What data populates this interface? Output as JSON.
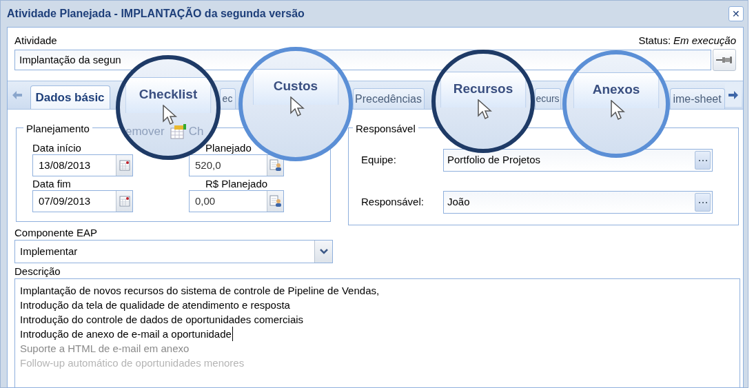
{
  "window": {
    "title": "Atividade Planejada - IMPLANTAÇÃO da segunda versão",
    "close": "✕"
  },
  "activity": {
    "label": "Atividade",
    "value": "Implantação da segun",
    "status_label": "Status:",
    "status_value": "Em execução"
  },
  "tabs": [
    {
      "label": "Dados básic",
      "selected": true
    },
    {
      "label": "ec",
      "selected": false
    },
    {
      "label": "Precedências",
      "selected": false
    },
    {
      "label": "ecurs",
      "selected": false
    },
    {
      "label": "ime-sheet",
      "selected": false
    }
  ],
  "planning": {
    "title": "Planejamento",
    "fields": [
      {
        "label": "Data início",
        "value": "13/08/2013",
        "kind": "date"
      },
      {
        "label": "Planejado",
        "value": "520,0",
        "kind": "calc"
      },
      {
        "label": "Data fim",
        "value": "07/09/2013",
        "kind": "date"
      },
      {
        "label": "R$ Planejado",
        "value": "0,00",
        "kind": "calc"
      }
    ]
  },
  "responsible": {
    "title": "Responsável",
    "fields": [
      {
        "label": "Equipe:",
        "value": "Portfolio de Projetos"
      },
      {
        "label": "Responsável:",
        "value": "João"
      }
    ]
  },
  "component": {
    "label": "Componente EAP",
    "value": "Implementar"
  },
  "description": {
    "label": "Descrição",
    "lines": [
      {
        "text": "Implantação de novos recursos do sistema de controle de Pipeline de Vendas,",
        "muted": false
      },
      {
        "text": "Introdução da tela de qualidade de atendimento e resposta",
        "muted": false
      },
      {
        "text": "Introdução do controle de dados de oportunidades comerciais",
        "muted": false
      },
      {
        "text": "Introdução de anexo de e-mail a oportunidade",
        "muted": false,
        "caret": true
      },
      {
        "text": "Suporte a HTML de e-mail em anexo",
        "muted": true
      },
      {
        "text": "Follow-up automático de oportunidades menores",
        "muted": true
      }
    ]
  },
  "lenses": [
    {
      "label": "Checklist",
      "color": "#1e3a66",
      "toolbar": [
        "emover",
        "Ch"
      ]
    },
    {
      "label": "Custos",
      "color": "#5b8fd6"
    },
    {
      "label": "Recursos",
      "color": "#1e3a66"
    },
    {
      "label": "Anexos",
      "color": "#5b8fd6"
    }
  ]
}
